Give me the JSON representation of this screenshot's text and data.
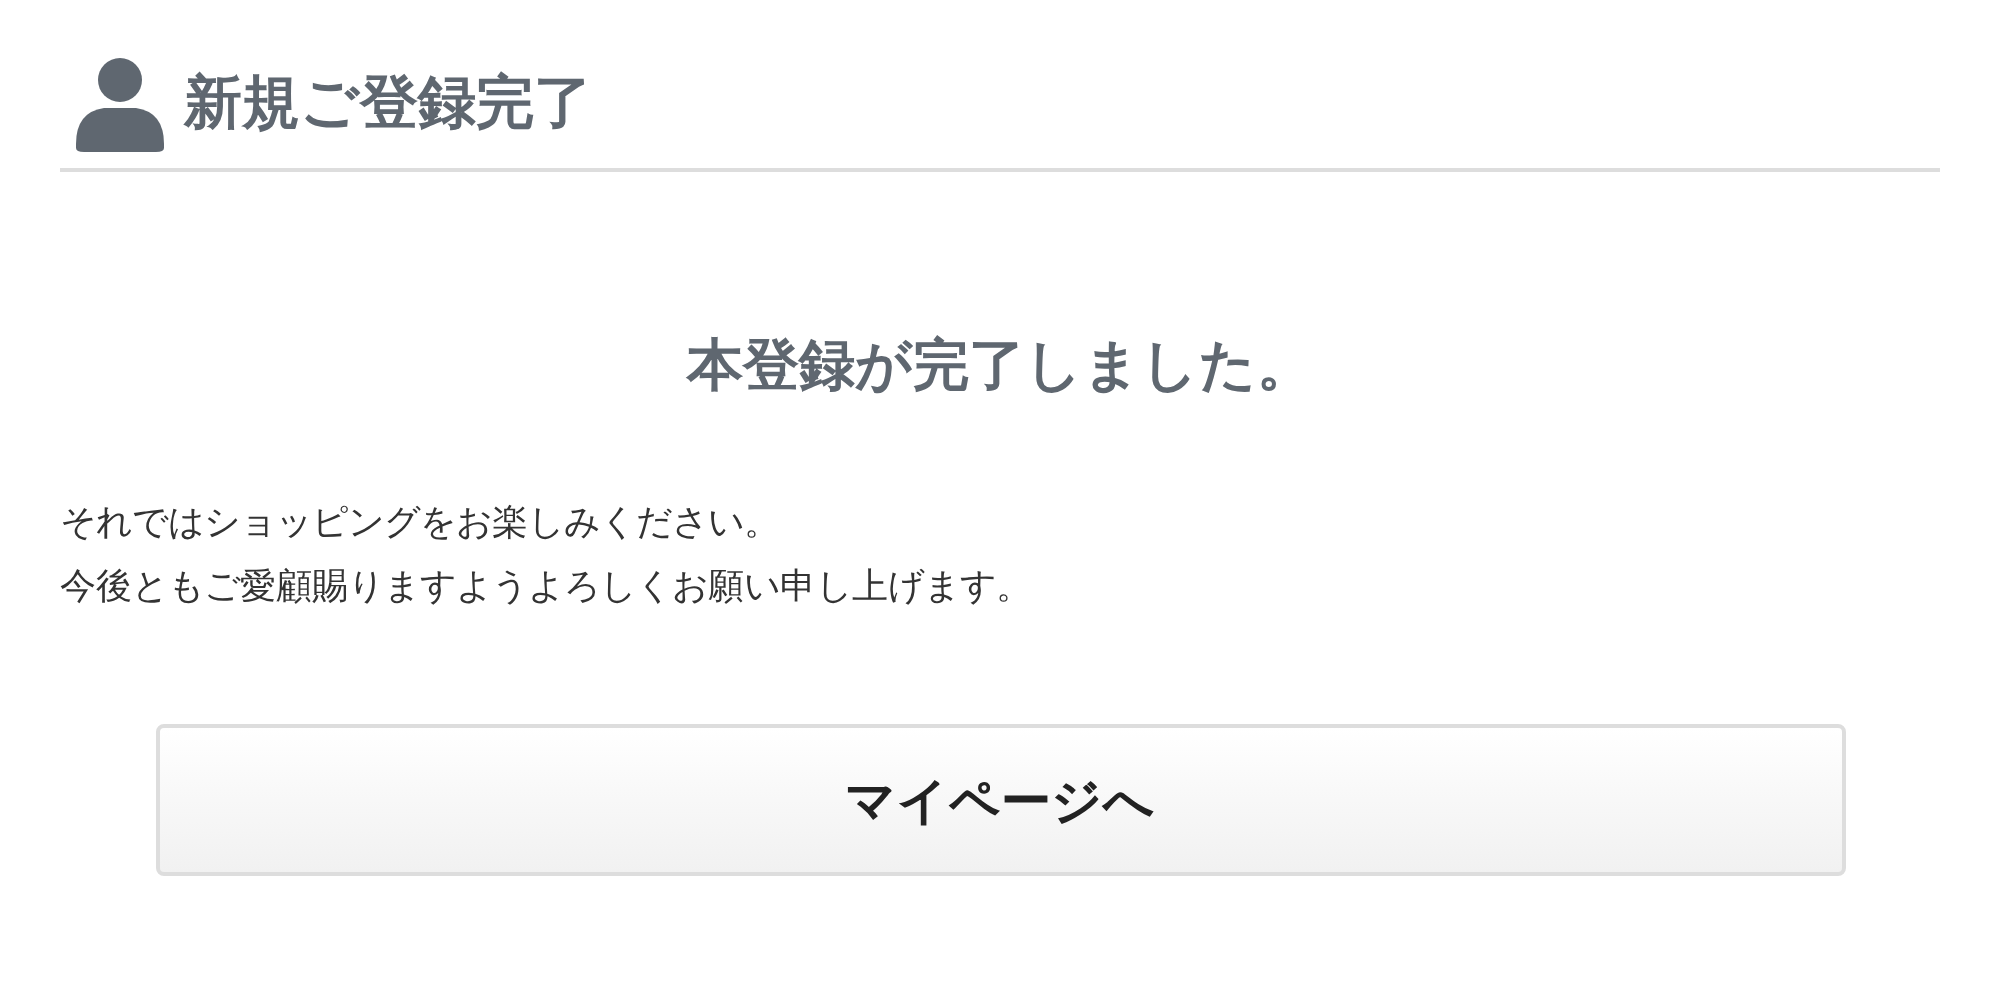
{
  "header": {
    "title": "新規ご登録完了"
  },
  "message": {
    "heading": "本登録が完了しました。",
    "lines": [
      "それではショッピングをお楽しみください。",
      "今後ともご愛顧賜りますようよろしくお願い申し上げます。"
    ]
  },
  "buttons": [
    "マイページへ"
  ]
}
